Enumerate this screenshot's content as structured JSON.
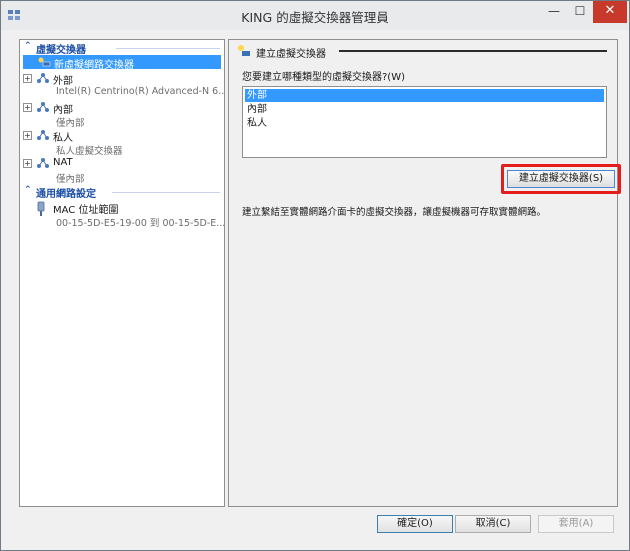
{
  "window": {
    "title": "KING 的虛擬交換器管理員",
    "minimize_glyph": "—",
    "maximize_glyph": "☐",
    "close_glyph": "✕"
  },
  "nav": {
    "section1": {
      "label": "虛擬交換器",
      "chevron": "⌃"
    },
    "new_switch": "新虛擬網路交換器",
    "items": [
      {
        "label": "外部",
        "sub": "Intel(R) Centrino(R) Advanced-N 6...",
        "expander": "+"
      },
      {
        "label": "內部",
        "sub": "僅內部",
        "expander": "+"
      },
      {
        "label": "私人",
        "sub": "私人虛擬交換器",
        "expander": "+"
      },
      {
        "label": "NAT",
        "sub": "僅內部",
        "expander": "+"
      }
    ],
    "section2": {
      "label": "通用網路設定",
      "chevron": "⌃"
    },
    "mac": {
      "label": "MAC 位址範圍",
      "sub": "00-15-5D-E5-19-00 到 00-15-5D-E..."
    }
  },
  "detail": {
    "section_title": "建立虛擬交換器",
    "question": "您要建立哪種類型的虛擬交換器?(W)",
    "options": [
      "外部",
      "內部",
      "私人"
    ],
    "selected_index": 0,
    "create_button": "建立虛擬交換器(S)",
    "description": "建立繫結至實體網路介面卡的虛擬交換器，讓虛擬機器可存取實體網路。"
  },
  "buttons": {
    "ok": "確定(O)",
    "cancel": "取消(C)",
    "apply": "套用(A)"
  },
  "colors": {
    "selection": "#3399ff",
    "header_blue": "#1c4fa7",
    "highlight_red": "#e51d1d",
    "close_red": "#c7392b"
  },
  "icons": {
    "app": "switch-manager-icon",
    "network": "network-switch-icon",
    "mac": "plug-icon"
  }
}
